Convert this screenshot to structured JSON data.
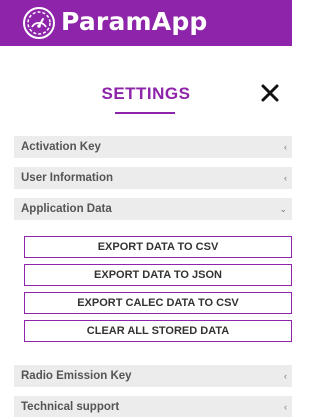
{
  "header": {
    "app_title": "ParamApp",
    "logo_icon": "dashboard-gauge-icon",
    "bg_color": "#8e24aa"
  },
  "settings": {
    "title": "SETTINGS",
    "close_icon": "close-icon"
  },
  "sections": [
    {
      "label": "Activation Key",
      "chevron": "‹",
      "expanded": false
    },
    {
      "label": "User Information",
      "chevron": "‹",
      "expanded": false
    },
    {
      "label": "Application Data",
      "chevron": "⌄",
      "expanded": true
    },
    {
      "label": "Radio Emission Key",
      "chevron": "‹",
      "expanded": false
    },
    {
      "label": "Technical support",
      "chevron": "‹",
      "expanded": false
    }
  ],
  "app_data_actions": [
    {
      "label": "EXPORT DATA TO CSV"
    },
    {
      "label": "EXPORT DATA TO JSON"
    },
    {
      "label": "EXPORT CALEC DATA TO CSV"
    },
    {
      "label": "CLEAR ALL STORED DATA"
    }
  ]
}
